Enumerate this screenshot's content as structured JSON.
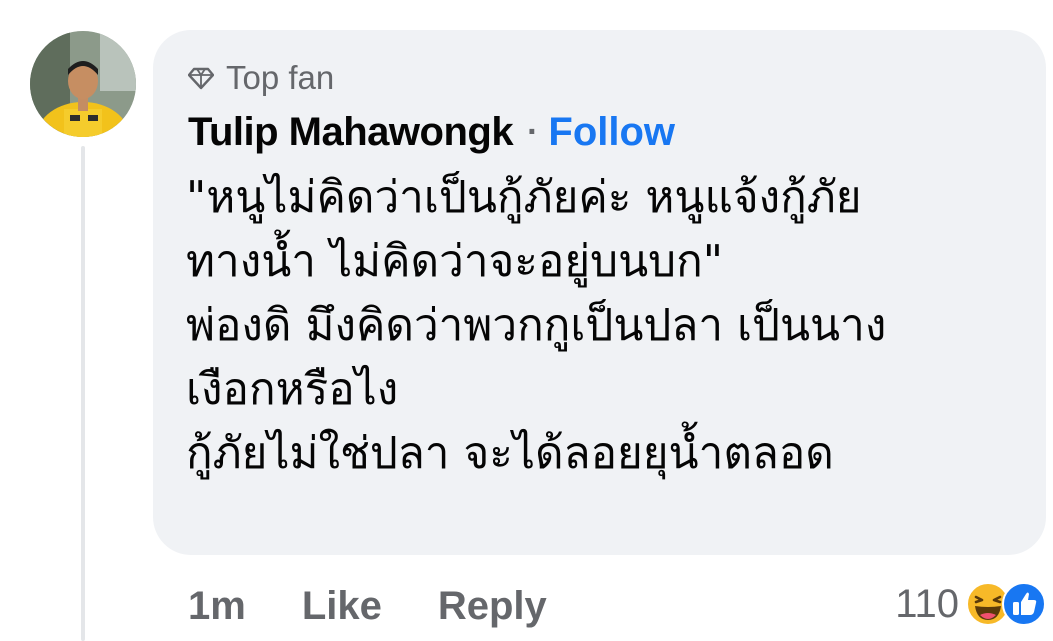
{
  "comment": {
    "badge_label": "Top fan",
    "badge_icon": "diamond-icon",
    "author": "Tulip Mahawongk",
    "separator": "·",
    "follow_label": "Follow",
    "body_lines": [
      "\"หนูไม่คิดว่าเป็นกู้ภัยค่ะ หนูแจ้งกู้ภัย",
      "ทางน้ำ ไม่คิดว่าจะอยู่บนบก\"",
      "พ่องดิ มึงคิดว่าพวกกูเป็นปลา เป็นนาง",
      "เงือกหรือไง",
      "กู้ภัยไม่ใช่ปลา จะได้ลอยยุน้ำตลอด"
    ],
    "timestamp": "1m",
    "like_label": "Like",
    "reply_label": "Reply",
    "reaction_count": "110",
    "reactions": [
      "haha-reaction-icon",
      "like-reaction-icon"
    ]
  },
  "colors": {
    "bubble": "#f0f2f5",
    "author": "#050505",
    "secondary": "#65676b",
    "link": "#1877f2",
    "like_reaction": "#1877f2",
    "haha_reaction": "#f7b928"
  }
}
